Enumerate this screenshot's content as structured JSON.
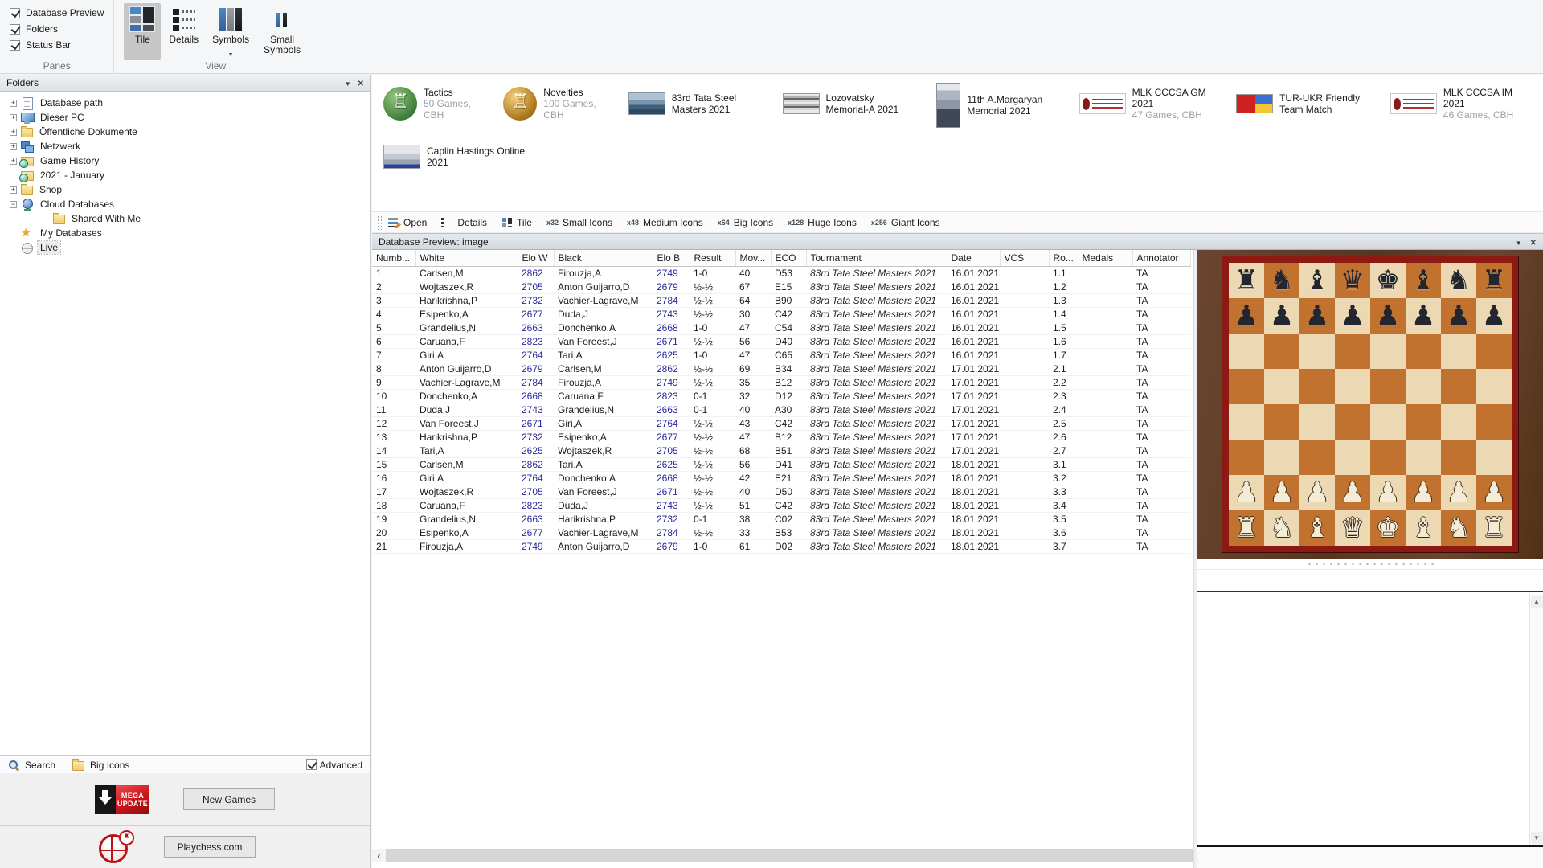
{
  "ribbon": {
    "panes_group": {
      "label": "Panes",
      "items": [
        {
          "label": "Database Preview",
          "checked": true
        },
        {
          "label": "Folders",
          "checked": true
        },
        {
          "label": "Status Bar",
          "checked": true
        }
      ]
    },
    "view_group": {
      "label": "View",
      "buttons": [
        {
          "label": "Tile",
          "icon": "tile-view-icon",
          "selected": true
        },
        {
          "label": "Details",
          "icon": "details-view-icon"
        },
        {
          "label": "Symbols",
          "icon": "symbols-view-icon",
          "has_dropdown": true
        },
        {
          "label": "Small Symbols",
          "icon": "small-symbols-view-icon"
        }
      ]
    }
  },
  "folders_panel": {
    "title": "Folders",
    "tree": [
      {
        "label": "Database path",
        "icon": "document-icon",
        "expander": "plus"
      },
      {
        "label": "Dieser PC",
        "icon": "computer-icon",
        "expander": "plus"
      },
      {
        "label": "Öffentliche Dokumente",
        "icon": "folder-icon",
        "expander": "plus"
      },
      {
        "label": "Netzwerk",
        "icon": "network-icon",
        "expander": "plus"
      },
      {
        "label": "Game History",
        "icon": "history-icon",
        "expander": "plus"
      },
      {
        "label": "2021 - January",
        "icon": "history-icon",
        "expander": "none"
      },
      {
        "label": "Shop",
        "icon": "folder-icon",
        "expander": "plus"
      },
      {
        "label": "Cloud Databases",
        "icon": "cloud-db-icon",
        "expander": "minus"
      },
      {
        "label": "Shared With Me",
        "icon": "folder-icon",
        "expander": "none",
        "indent": 1
      },
      {
        "label": "My Databases",
        "icon": "star-icon",
        "expander": "none"
      },
      {
        "label": "Live",
        "icon": "globe-icon",
        "expander": "none",
        "selected": true
      }
    ],
    "search_row": {
      "search_label": "Search",
      "view_mode_label": "Big Icons",
      "advanced_label": "Advanced",
      "advanced_checked": true
    },
    "promos": {
      "mega_update_lines": [
        "MEGA",
        "UPDATE"
      ],
      "new_games_button": "New Games",
      "playchess_button": "Playchess.com"
    }
  },
  "database_tiles": {
    "rows": [
      [
        {
          "title": "Tactics",
          "subtitle": "50 Games, CBH",
          "icon": "tactics-icon"
        },
        {
          "title": "Novelties",
          "subtitle": "100 Games, CBH",
          "icon": "novelties-icon"
        },
        {
          "title": "83rd Tata Steel Masters 2021",
          "icon": "photo-sea-icon"
        },
        {
          "title": "Lozovatsky Memorial-A 2021",
          "icon": "photo-bw-icon"
        },
        {
          "title": "11th A.Margaryan Memorial 2021",
          "icon": "poster-icon"
        },
        {
          "title": "MLK CCCSA GM 2021",
          "subtitle": "47 Games, CBH",
          "icon": "mlk-logo-icon"
        },
        {
          "title": "TUR-UKR Friendly Team Match",
          "icon": "flags-icon"
        },
        {
          "title": "MLK CCCSA IM 2021",
          "subtitle": "46 Games, CBH",
          "icon": "mlk-logo-icon"
        }
      ],
      [
        {
          "title": "Caplin Hastings Online 2021",
          "icon": "photo-hastings-icon"
        }
      ]
    ]
  },
  "list_toolbar": {
    "items": [
      {
        "label": "Open",
        "icon": "open-icon"
      },
      {
        "label": "Details",
        "icon": "details-list-icon"
      },
      {
        "label": "Tile",
        "icon": "tile-list-icon"
      },
      {
        "label": "Small Icons",
        "size_prefix": "x32"
      },
      {
        "label": "Medium Icons",
        "size_prefix": "x48"
      },
      {
        "label": "Big Icons",
        "size_prefix": "x64"
      },
      {
        "label": "Huge Icons",
        "size_prefix": "x128"
      },
      {
        "label": "Giant Icons",
        "size_prefix": "x256"
      }
    ]
  },
  "preview_panel": {
    "title": "Database Preview: image"
  },
  "games_table": {
    "elo_color": "#28289a",
    "columns": [
      "Numb...",
      "White",
      "Elo W",
      "Black",
      "Elo B",
      "Result",
      "Mov...",
      "ECO",
      "Tournament",
      "Date",
      "VCS",
      "Ro...",
      "Medals",
      "Annotator"
    ],
    "rows": [
      [
        "1",
        "Carlsen,M",
        "2862",
        "Firouzja,A",
        "2749",
        "1-0",
        "40",
        "D53",
        "83rd Tata Steel Masters 2021",
        "16.01.2021",
        "",
        "1.1",
        "",
        "TA"
      ],
      [
        "2",
        "Wojtaszek,R",
        "2705",
        "Anton Guijarro,D",
        "2679",
        "½-½",
        "67",
        "E15",
        "83rd Tata Steel Masters 2021",
        "16.01.2021",
        "",
        "1.2",
        "",
        "TA"
      ],
      [
        "3",
        "Harikrishna,P",
        "2732",
        "Vachier-Lagrave,M",
        "2784",
        "½-½",
        "64",
        "B90",
        "83rd Tata Steel Masters 2021",
        "16.01.2021",
        "",
        "1.3",
        "",
        "TA"
      ],
      [
        "4",
        "Esipenko,A",
        "2677",
        "Duda,J",
        "2743",
        "½-½",
        "30",
        "C42",
        "83rd Tata Steel Masters 2021",
        "16.01.2021",
        "",
        "1.4",
        "",
        "TA"
      ],
      [
        "5",
        "Grandelius,N",
        "2663",
        "Donchenko,A",
        "2668",
        "1-0",
        "47",
        "C54",
        "83rd Tata Steel Masters 2021",
        "16.01.2021",
        "",
        "1.5",
        "",
        "TA"
      ],
      [
        "6",
        "Caruana,F",
        "2823",
        "Van Foreest,J",
        "2671",
        "½-½",
        "56",
        "D40",
        "83rd Tata Steel Masters 2021",
        "16.01.2021",
        "",
        "1.6",
        "",
        "TA"
      ],
      [
        "7",
        "Giri,A",
        "2764",
        "Tari,A",
        "2625",
        "1-0",
        "47",
        "C65",
        "83rd Tata Steel Masters 2021",
        "16.01.2021",
        "",
        "1.7",
        "",
        "TA"
      ],
      [
        "8",
        "Anton Guijarro,D",
        "2679",
        "Carlsen,M",
        "2862",
        "½-½",
        "69",
        "B34",
        "83rd Tata Steel Masters 2021",
        "17.01.2021",
        "",
        "2.1",
        "",
        "TA"
      ],
      [
        "9",
        "Vachier-Lagrave,M",
        "2784",
        "Firouzja,A",
        "2749",
        "½-½",
        "35",
        "B12",
        "83rd Tata Steel Masters 2021",
        "17.01.2021",
        "",
        "2.2",
        "",
        "TA"
      ],
      [
        "10",
        "Donchenko,A",
        "2668",
        "Caruana,F",
        "2823",
        "0-1",
        "32",
        "D12",
        "83rd Tata Steel Masters 2021",
        "17.01.2021",
        "",
        "2.3",
        "",
        "TA"
      ],
      [
        "11",
        "Duda,J",
        "2743",
        "Grandelius,N",
        "2663",
        "0-1",
        "40",
        "A30",
        "83rd Tata Steel Masters 2021",
        "17.01.2021",
        "",
        "2.4",
        "",
        "TA"
      ],
      [
        "12",
        "Van Foreest,J",
        "2671",
        "Giri,A",
        "2764",
        "½-½",
        "43",
        "C42",
        "83rd Tata Steel Masters 2021",
        "17.01.2021",
        "",
        "2.5",
        "",
        "TA"
      ],
      [
        "13",
        "Harikrishna,P",
        "2732",
        "Esipenko,A",
        "2677",
        "½-½",
        "47",
        "B12",
        "83rd Tata Steel Masters 2021",
        "17.01.2021",
        "",
        "2.6",
        "",
        "TA"
      ],
      [
        "14",
        "Tari,A",
        "2625",
        "Wojtaszek,R",
        "2705",
        "½-½",
        "68",
        "B51",
        "83rd Tata Steel Masters 2021",
        "17.01.2021",
        "",
        "2.7",
        "",
        "TA"
      ],
      [
        "15",
        "Carlsen,M",
        "2862",
        "Tari,A",
        "2625",
        "½-½",
        "56",
        "D41",
        "83rd Tata Steel Masters 2021",
        "18.01.2021",
        "",
        "3.1",
        "",
        "TA"
      ],
      [
        "16",
        "Giri,A",
        "2764",
        "Donchenko,A",
        "2668",
        "½-½",
        "42",
        "E21",
        "83rd Tata Steel Masters 2021",
        "18.01.2021",
        "",
        "3.2",
        "",
        "TA"
      ],
      [
        "17",
        "Wojtaszek,R",
        "2705",
        "Van Foreest,J",
        "2671",
        "½-½",
        "40",
        "D50",
        "83rd Tata Steel Masters 2021",
        "18.01.2021",
        "",
        "3.3",
        "",
        "TA"
      ],
      [
        "18",
        "Caruana,F",
        "2823",
        "Duda,J",
        "2743",
        "½-½",
        "51",
        "C42",
        "83rd Tata Steel Masters 2021",
        "18.01.2021",
        "",
        "3.4",
        "",
        "TA"
      ],
      [
        "19",
        "Grandelius,N",
        "2663",
        "Harikrishna,P",
        "2732",
        "0-1",
        "38",
        "C02",
        "83rd Tata Steel Masters 2021",
        "18.01.2021",
        "",
        "3.5",
        "",
        "TA"
      ],
      [
        "20",
        "Esipenko,A",
        "2677",
        "Vachier-Lagrave,M",
        "2784",
        "½-½",
        "33",
        "B53",
        "83rd Tata Steel Masters 2021",
        "18.01.2021",
        "",
        "3.6",
        "",
        "TA"
      ],
      [
        "21",
        "Firouzja,A",
        "2749",
        "Anton Guijarro,D",
        "2679",
        "1-0",
        "61",
        "D02",
        "83rd Tata Steel Masters 2021",
        "18.01.2021",
        "",
        "3.7",
        "",
        "TA"
      ]
    ]
  },
  "board": {
    "ranks": [
      "rnbqkbnr",
      "pppppppp",
      "",
      "",
      "",
      "",
      "PPPPPPPP",
      "RNBQKBNR"
    ],
    "light_square_color": "#ecd9b4",
    "dark_square_color": "#c2722f",
    "frame_color": "#8c1a12",
    "wood_color": "#5e3c28"
  }
}
